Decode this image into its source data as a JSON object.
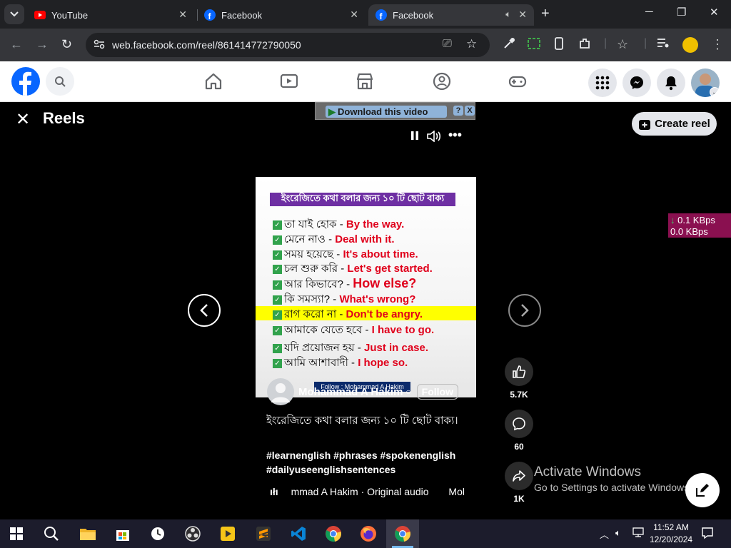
{
  "browser": {
    "tabs": [
      {
        "title": "YouTube",
        "active": false
      },
      {
        "title": "Facebook",
        "active": false
      },
      {
        "title": "Facebook",
        "active": true
      }
    ],
    "url": "web.facebook.com/reel/861414772790050"
  },
  "reels": {
    "header": "Reels",
    "download_label": "Download this video",
    "download_help": "?",
    "download_close": "X",
    "create_reel_label": "Create reel",
    "video": {
      "title": "ইংরেজিতে কথা বলার জন্য ১০ টি ছোট বাক্য",
      "lines": [
        {
          "bn": "তা যাই হোক -",
          "en": "By the way."
        },
        {
          "bn": "মেনে নাও -",
          "en": "Deal with it."
        },
        {
          "bn": "সময় হয়েছে -",
          "en": "It's about time."
        },
        {
          "bn": "চল শুরু করি -",
          "en": "Let's get started."
        },
        {
          "bn": "আর কিভাবে? -",
          "en": "How else?"
        },
        {
          "bn": "কি সমস্যা? -",
          "en": "What's wrong?"
        },
        {
          "bn": "রাগ করো না -",
          "en": "Don't be angry."
        },
        {
          "bn": "আমাকে যেতে হবে -",
          "en": "I have to go."
        },
        {
          "bn": "যদি প্রয়োজন হয় -",
          "en": "Just in case."
        },
        {
          "bn": "আমি আশাবাদী -",
          "en": "I hope so."
        }
      ],
      "follow_tag": "Follow : Mohammad A Hakim"
    },
    "author": "Mohammad A Hakim",
    "follow_label": "Follow",
    "caption": "ইংরেজিতে কথা বলার জন্য ১০ টি ছোট বাক্য।",
    "hashtags": "#learnenglish #phrases #spokenenglish #dailyuseenglishsentences",
    "audio": "mmad A Hakim · Original audio",
    "audio_more": "Mol",
    "likes": "5.7K",
    "comments": "60",
    "shares": "1K"
  },
  "netmeter": {
    "down": "0.1 KBps",
    "up": "0.0 KBps"
  },
  "activate": {
    "line1": "Activate Windows",
    "line2": "Go to Settings to activate Windows."
  },
  "taskbar": {
    "time": "11:52 AM",
    "date": "12/20/2024"
  }
}
